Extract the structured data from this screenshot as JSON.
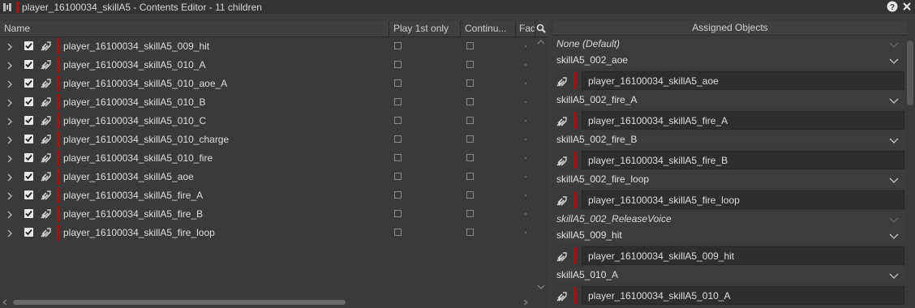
{
  "window": {
    "title": "player_16100034_skillA5 - Contents Editor - 11 children"
  },
  "left_table": {
    "columns": [
      "Name",
      "Play 1st only",
      "Continu...",
      "Fad"
    ],
    "rows": [
      {
        "name": "player_16100034_skillA5_009_hit",
        "checked": true
      },
      {
        "name": "player_16100034_skillA5_010_A",
        "checked": true
      },
      {
        "name": "player_16100034_skillA5_010_aoe_A",
        "checked": true
      },
      {
        "name": "player_16100034_skillA5_010_B",
        "checked": true
      },
      {
        "name": "player_16100034_skillA5_010_C",
        "checked": true
      },
      {
        "name": "player_16100034_skillA5_010_charge",
        "checked": true
      },
      {
        "name": "player_16100034_skillA5_010_fire",
        "checked": true
      },
      {
        "name": "player_16100034_skillA5_aoe",
        "checked": true
      },
      {
        "name": "player_16100034_skillA5_fire_A",
        "checked": true
      },
      {
        "name": "player_16100034_skillA5_fire_B",
        "checked": true
      },
      {
        "name": "player_16100034_skillA5_fire_loop",
        "checked": true
      }
    ]
  },
  "assigned_objects": {
    "header": "Assigned Objects",
    "groups": [
      {
        "label": "None (Default)",
        "italic": true,
        "children": []
      },
      {
        "label": "skillA5_002_aoe",
        "italic": false,
        "children": [
          "player_16100034_skillA5_aoe"
        ]
      },
      {
        "label": "skillA5_002_fire_A",
        "italic": false,
        "children": [
          "player_16100034_skillA5_fire_A"
        ]
      },
      {
        "label": "skillA5_002_fire_B",
        "italic": false,
        "children": [
          "player_16100034_skillA5_fire_B"
        ]
      },
      {
        "label": "skillA5_002_fire_loop",
        "italic": false,
        "children": [
          "player_16100034_skillA5_fire_loop"
        ]
      },
      {
        "label": "skillA5_002_ReleaseVoice",
        "italic": true,
        "children": []
      },
      {
        "label": "skillA5_009_hit",
        "italic": false,
        "children": [
          "player_16100034_skillA5_009_hit"
        ]
      },
      {
        "label": "skillA5_010_A",
        "italic": false,
        "children": [
          "player_16100034_skillA5_010_A"
        ]
      }
    ]
  },
  "icons": {
    "window_icon": "contents-editor-icon",
    "help": "help-icon",
    "close": "close-icon",
    "search": "search-icon",
    "row_expand": "chevron-right-icon",
    "sound": "sound-object-icon",
    "group_toggle": "chevron-down-icon"
  },
  "colors": {
    "accent_red": "#8a1c1c",
    "background": "#3c3c3c"
  }
}
